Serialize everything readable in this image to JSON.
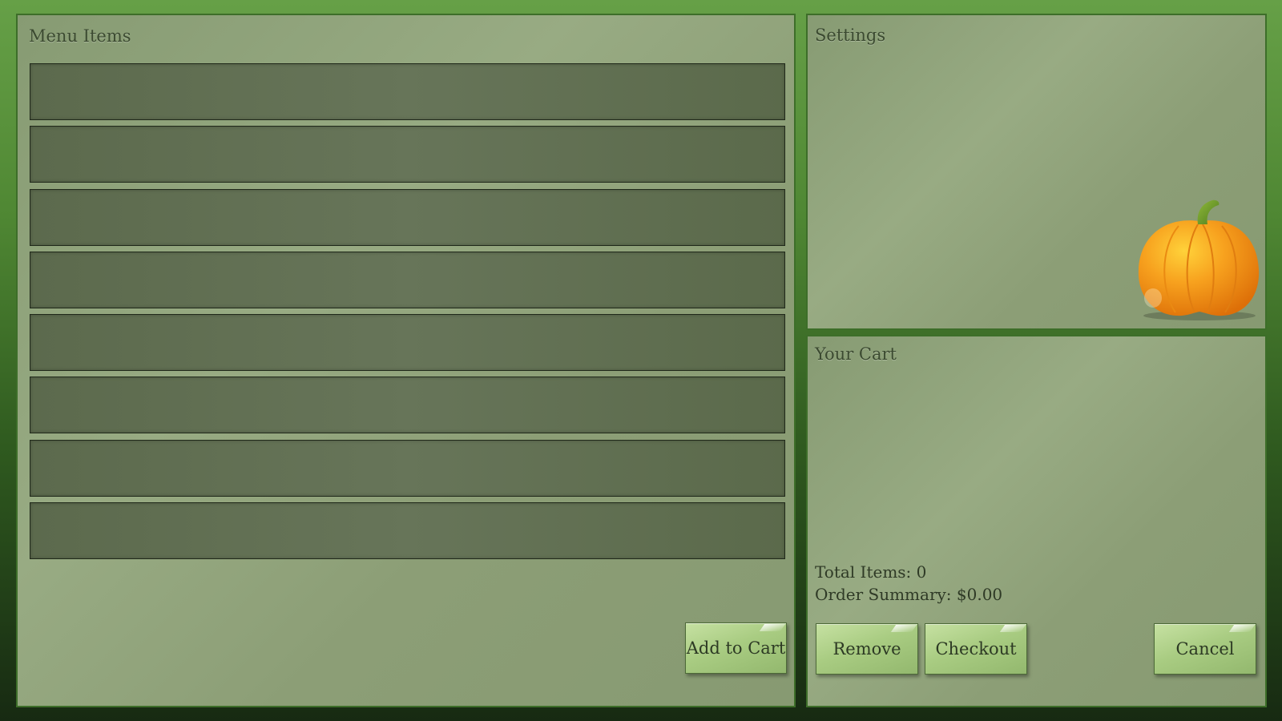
{
  "menu": {
    "title": "Menu Items",
    "slots": [
      "",
      "",
      "",
      "",
      "",
      "",
      "",
      ""
    ],
    "add_to_cart_label": "Add to Cart"
  },
  "settings": {
    "title": "Settings",
    "illustration": "pumpkin-icon"
  },
  "cart": {
    "title": "Your Cart",
    "total_items": "Total Items: 0",
    "order_summary": "Order Summary: $0.00",
    "remove_label": "Remove",
    "checkout_label": "Checkout",
    "cancel_label": "Cancel"
  },
  "colors": {
    "background_top": "#66a047",
    "background_bottom": "#172a12",
    "panel": "#8c9e76",
    "menu_slot": "#627055",
    "button": "#a9cc82",
    "pumpkin": "#f39419"
  }
}
